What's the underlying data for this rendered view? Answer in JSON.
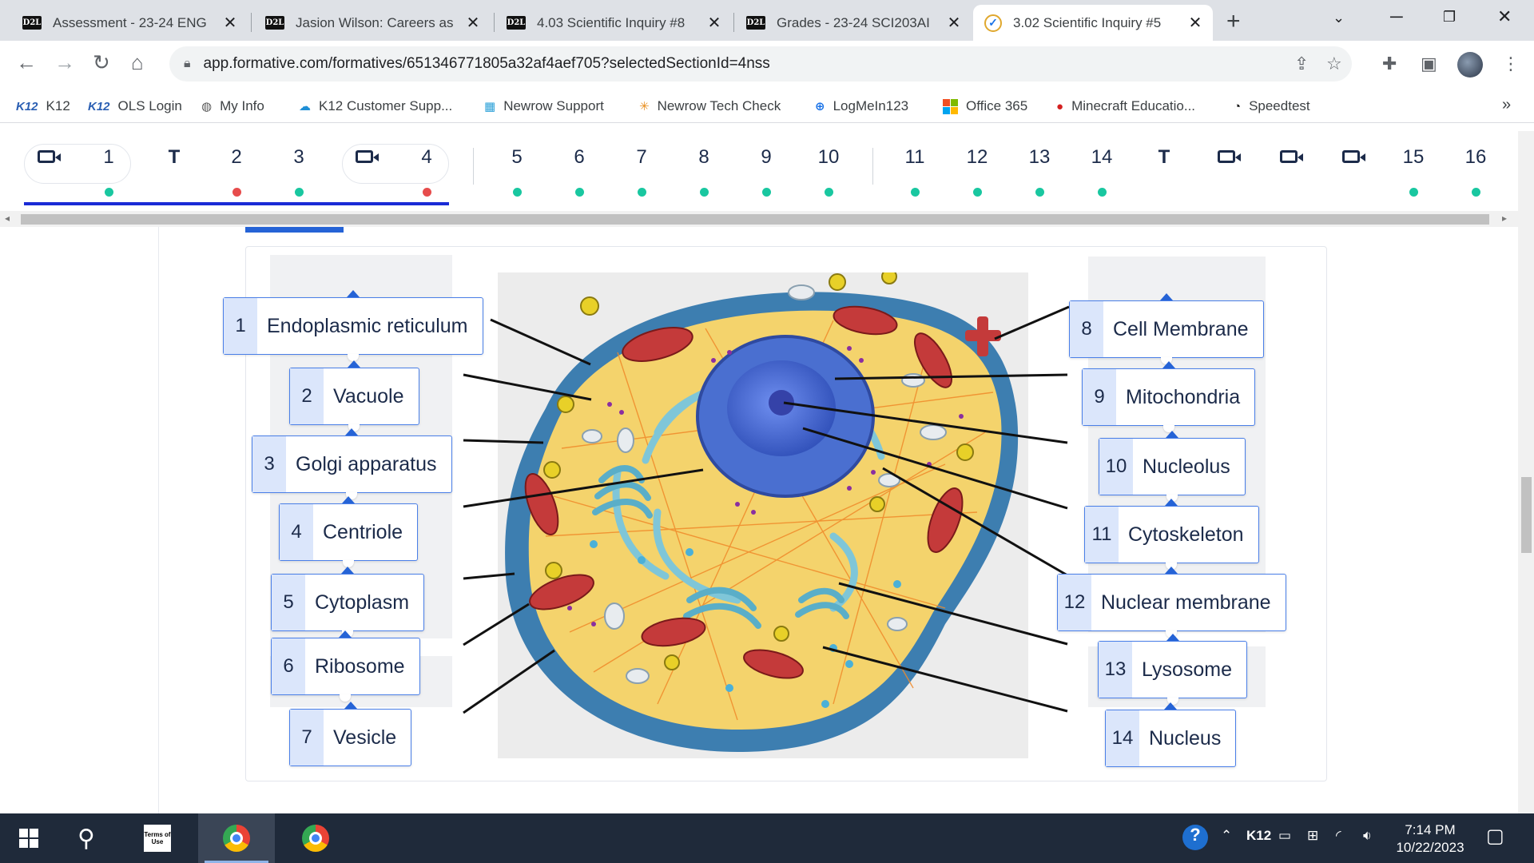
{
  "browser": {
    "tabs": [
      {
        "favicon": "D2L",
        "title": "Assessment - 23-24 ENG",
        "active": false
      },
      {
        "favicon": "D2L",
        "title": "Jasion Wilson: Careers as",
        "active": false
      },
      {
        "favicon": "D2L",
        "title": "4.03 Scientific Inquiry #8",
        "active": false
      },
      {
        "favicon": "D2L",
        "title": "Grades - 23-24 SCI203AI",
        "active": false
      },
      {
        "favicon": "formative",
        "title": "3.02 Scientific Inquiry #5",
        "active": true
      }
    ],
    "url": "app.formative.com/formatives/651346771805a32af4aef705?selectedSectionId=4nss",
    "bookmarks": [
      {
        "icon": "K12",
        "label": "K12"
      },
      {
        "icon": "K12",
        "label": "OLS Login"
      },
      {
        "icon": "globe-icon",
        "label": "My Info"
      },
      {
        "icon": "cloud-icon",
        "label": "K12 Customer Supp..."
      },
      {
        "icon": "newrow-icon",
        "label": "Newrow Support"
      },
      {
        "icon": "sparkle-icon",
        "label": "Newrow Tech Check"
      },
      {
        "icon": "plus-circle-icon",
        "label": "LogMeIn123"
      },
      {
        "icon": "office-icon",
        "label": "Office 365"
      },
      {
        "icon": "apple-icon",
        "label": "Minecraft Educatio..."
      },
      {
        "icon": "speedtest-icon",
        "label": "Speedtest"
      }
    ],
    "bookmarks_more": "»"
  },
  "question_nav": {
    "items": [
      {
        "kind": "video",
        "label": "",
        "dot": ""
      },
      {
        "kind": "num",
        "label": "1",
        "dot": "green"
      },
      {
        "kind": "text",
        "label": "T",
        "dot": ""
      },
      {
        "kind": "num",
        "label": "2",
        "dot": "red"
      },
      {
        "kind": "num",
        "label": "3",
        "dot": "green"
      },
      {
        "kind": "video",
        "label": "",
        "dot": ""
      },
      {
        "kind": "num",
        "label": "4",
        "dot": "red"
      },
      {
        "kind": "num",
        "label": "5",
        "dot": "green"
      },
      {
        "kind": "num",
        "label": "6",
        "dot": "green"
      },
      {
        "kind": "num",
        "label": "7",
        "dot": "green"
      },
      {
        "kind": "num",
        "label": "8",
        "dot": "green"
      },
      {
        "kind": "num",
        "label": "9",
        "dot": "green"
      },
      {
        "kind": "num",
        "label": "10",
        "dot": "green"
      },
      {
        "kind": "num",
        "label": "11",
        "dot": "green"
      },
      {
        "kind": "num",
        "label": "12",
        "dot": "green"
      },
      {
        "kind": "num",
        "label": "13",
        "dot": "green"
      },
      {
        "kind": "num",
        "label": "14",
        "dot": "green"
      },
      {
        "kind": "text",
        "label": "T",
        "dot": ""
      },
      {
        "kind": "video",
        "label": "",
        "dot": ""
      },
      {
        "kind": "video",
        "label": "",
        "dot": ""
      },
      {
        "kind": "video",
        "label": "",
        "dot": ""
      },
      {
        "kind": "num",
        "label": "15",
        "dot": "green"
      },
      {
        "kind": "num",
        "label": "16",
        "dot": "green"
      }
    ]
  },
  "labels_left": [
    {
      "num": "1",
      "text": "Endoplasmic reticulum"
    },
    {
      "num": "2",
      "text": "Vacuole"
    },
    {
      "num": "3",
      "text": "Golgi apparatus"
    },
    {
      "num": "4",
      "text": "Centriole"
    },
    {
      "num": "5",
      "text": "Cytoplasm"
    },
    {
      "num": "6",
      "text": "Ribosome"
    },
    {
      "num": "7",
      "text": "Vesicle"
    }
  ],
  "labels_right": [
    {
      "num": "8",
      "text": "Cell Membrane"
    },
    {
      "num": "9",
      "text": "Mitochondria"
    },
    {
      "num": "10",
      "text": "Nucleolus"
    },
    {
      "num": "11",
      "text": "Cytoskeleton"
    },
    {
      "num": "12",
      "text": "Nuclear membrane"
    },
    {
      "num": "13",
      "text": "Lysosome"
    },
    {
      "num": "14",
      "text": "Nucleus"
    }
  ],
  "taskbar": {
    "items": [
      "windows-start-icon",
      "search-icon",
      "terms-of-use-icon",
      "chrome-icon",
      "chrome-icon"
    ],
    "terms_label": "Terms of Use",
    "tray_label": "K12",
    "time": "7:14 PM",
    "date": "10/22/2023"
  },
  "colors": {
    "accent_blue": "#2563d6",
    "status_green": "#19c7a0",
    "status_red": "#e74c4c",
    "label_num_bg": "#dbe6fb"
  }
}
